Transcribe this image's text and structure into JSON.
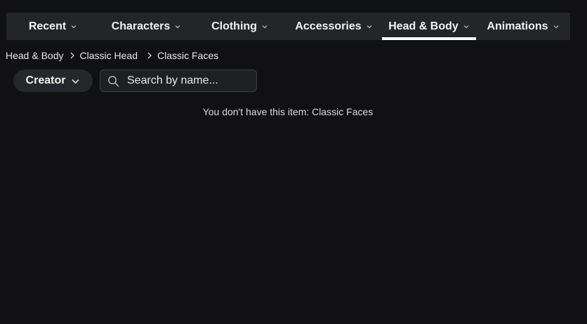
{
  "nav": {
    "tabs": [
      {
        "label": "Recent",
        "active": false
      },
      {
        "label": "Characters",
        "active": false
      },
      {
        "label": "Clothing",
        "active": false
      },
      {
        "label": "Accessories",
        "active": false
      },
      {
        "label": "Head & Body",
        "active": true
      },
      {
        "label": "Animations",
        "active": false
      }
    ]
  },
  "breadcrumb": {
    "items": [
      "Head & Body",
      "Classic Head",
      "Classic Faces"
    ]
  },
  "filters": {
    "creator_label": "Creator",
    "search_placeholder": "Search by name...",
    "search_value": ""
  },
  "main": {
    "empty_message": "You don't have this item: Classic Faces"
  },
  "colors": {
    "background": "#111114",
    "nav_background": "#232529",
    "active_underline": "#ffffff"
  },
  "icons": {
    "tab_chevron": "chevron-down-icon",
    "breadcrumb_separator": "chevron-right-icon",
    "search": "search-icon"
  }
}
